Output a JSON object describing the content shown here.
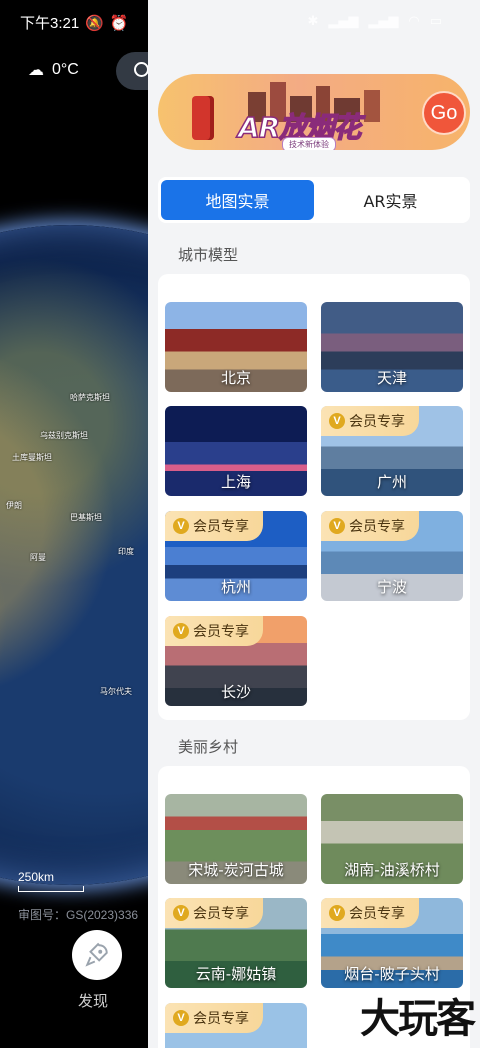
{
  "status": {
    "time": "下午3:21"
  },
  "weather": {
    "temp": "0°C"
  },
  "map": {
    "labels": [
      "哈萨克斯坦",
      "乌兹别克斯坦",
      "土库曼斯坦",
      "伊朗",
      "巴基斯坦",
      "印度",
      "阿曼",
      "马尔代夫"
    ],
    "scale": "250km",
    "map_number": "审图号：GS(2023)336"
  },
  "discover": {
    "label": "发现"
  },
  "banner": {
    "title": "AR放烟花",
    "subtitle": "技术新体验",
    "go": "Go"
  },
  "tabs": [
    {
      "label": "地图实景",
      "active": true
    },
    {
      "label": "AR实景",
      "active": false
    }
  ],
  "vip_badge": {
    "mark": "V",
    "label": "会员专享"
  },
  "city_section": {
    "title": "城市模型",
    "tiles": [
      {
        "label": "北京",
        "vip": false
      },
      {
        "label": "天津",
        "vip": false
      },
      {
        "label": "上海",
        "vip": false
      },
      {
        "label": "广州",
        "vip": true
      },
      {
        "label": "杭州",
        "vip": true
      },
      {
        "label": "宁波",
        "vip": true
      },
      {
        "label": "长沙",
        "vip": true
      }
    ]
  },
  "village_section": {
    "title": "美丽乡村",
    "tiles": [
      {
        "label": "宋城-炭河古城",
        "vip": false
      },
      {
        "label": "湖南-油溪桥村",
        "vip": false
      },
      {
        "label": "云南-娜姑镇",
        "vip": true
      },
      {
        "label": "烟台-陂子头村",
        "vip": true
      },
      {
        "label": "",
        "vip": true
      }
    ]
  },
  "watermark": "大玩客"
}
